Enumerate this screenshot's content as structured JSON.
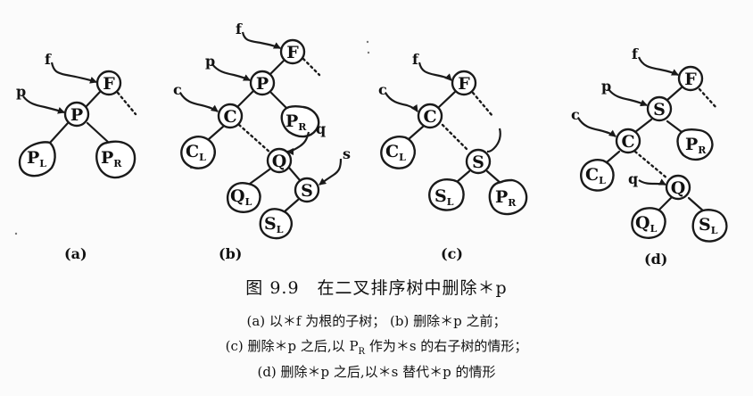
{
  "figure": {
    "title": "图 9.9　在二叉排序树中删除＊p",
    "lines": [
      "(a) 以＊f 为根的子树；  (b) 删除＊p 之前；",
      "(c) 删除＊p 之后,以 PR 作为＊s 的右子树的情形；",
      "(d) 删除＊p 之后,以＊s 替代＊p 的情形"
    ],
    "line_c_parts": {
      "before": "(c) 删除＊p 之后,以 P",
      "sub": "R",
      "after": " 作为＊s 的右子树的情形；"
    }
  },
  "panels": [
    {
      "id": "a",
      "caption": "(a)",
      "nodes": [
        "F",
        "P"
      ],
      "subtrees": [
        {
          "main": "P",
          "sub": "L"
        },
        {
          "main": "P",
          "sub": "R"
        }
      ],
      "pointers": [
        "f",
        "p"
      ]
    },
    {
      "id": "b",
      "caption": "(b)",
      "nodes": [
        "F",
        "P",
        "C",
        "Q",
        "S"
      ],
      "subtrees": [
        {
          "main": "P",
          "sub": "R"
        },
        {
          "main": "C",
          "sub": "L"
        },
        {
          "main": "Q",
          "sub": "L"
        },
        {
          "main": "S",
          "sub": "L"
        }
      ],
      "pointers": [
        "f",
        "p",
        "c",
        "q",
        "s"
      ]
    },
    {
      "id": "c",
      "caption": "(c)",
      "nodes": [
        "F",
        "C",
        "S"
      ],
      "subtrees": [
        {
          "main": "C",
          "sub": "L"
        },
        {
          "main": "S",
          "sub": "L"
        },
        {
          "main": "P",
          "sub": "R"
        }
      ],
      "pointers": [
        "f",
        "c"
      ]
    },
    {
      "id": "d",
      "caption": "(d)",
      "nodes": [
        "F",
        "S",
        "C",
        "Q"
      ],
      "subtrees": [
        {
          "main": "P",
          "sub": "R"
        },
        {
          "main": "C",
          "sub": "L"
        },
        {
          "main": "Q",
          "sub": "L"
        },
        {
          "main": "S",
          "sub": "L"
        }
      ],
      "pointers": [
        "f",
        "p",
        "c",
        "q"
      ]
    }
  ]
}
